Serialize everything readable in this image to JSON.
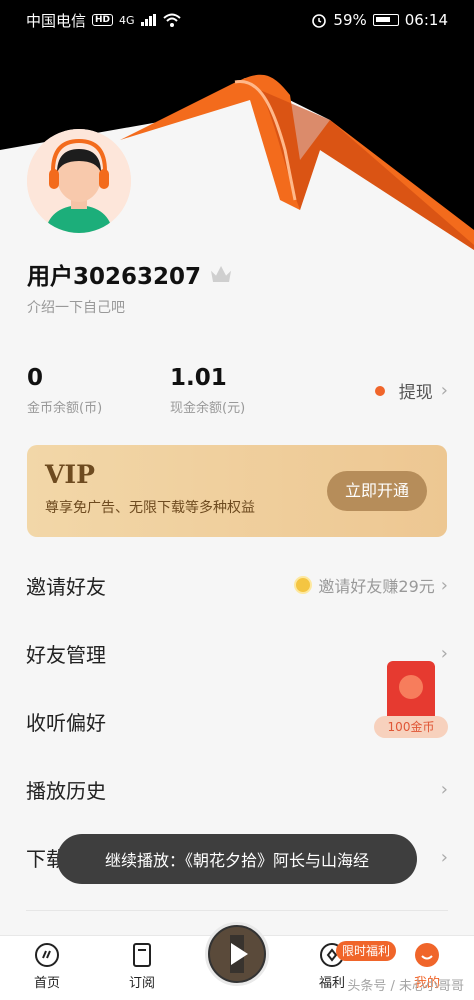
{
  "status_bar": {
    "carrier": "中国电信",
    "hd": "HD",
    "network": "4G",
    "battery": "59%",
    "time": "06:14"
  },
  "profile": {
    "username": "用户30263207",
    "bio": "介绍一下自己吧"
  },
  "stats": {
    "coins_value": "0",
    "coins_label": "金币余额(币)",
    "cash_value": "1.01",
    "cash_label": "现金余额(元)",
    "withdraw_label": "提现"
  },
  "vip": {
    "title": "VIP",
    "description": "尊享免广告、无限下载等多种权益",
    "button": "立即开通"
  },
  "menu": {
    "invite": "邀请好友",
    "invite_hint": "邀请好友赚29元",
    "friends": "好友管理",
    "preferences": "收听偏好",
    "history": "播放历史",
    "download_partial": "下载"
  },
  "redpacket": {
    "label": "100金币"
  },
  "toast": {
    "text": "继续播放：《朝花夕拾》阿长与山海经"
  },
  "tabbar": {
    "home": "首页",
    "subscribe": "订阅",
    "welfare": "福利",
    "welfare_badge": "限时福利",
    "mine": "我的"
  },
  "watermark": "头条号 / 未心小哥哥",
  "colors": {
    "accent": "#f0652a",
    "vip_text": "#6e4b20",
    "vip_button": "#b68d5a",
    "toast_bg": "#3e3e3e"
  },
  "icons": {
    "home": "home-icon",
    "subscribe": "bookmark-icon",
    "welfare": "coin-icon",
    "mine": "smile-icon"
  }
}
